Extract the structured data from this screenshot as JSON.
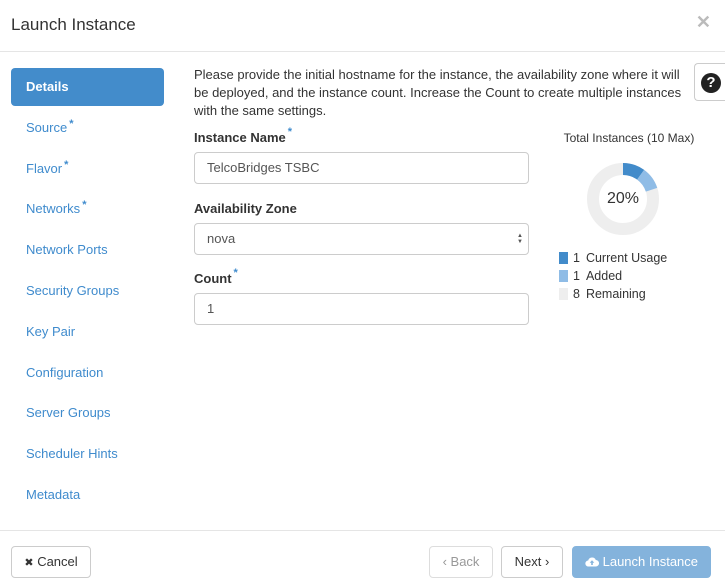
{
  "header": {
    "title": "Launch Instance",
    "close_icon": "close-icon"
  },
  "sidebar": {
    "items": [
      {
        "label": "Details",
        "active": true,
        "required": false
      },
      {
        "label": "Source",
        "active": false,
        "required": true
      },
      {
        "label": "Flavor",
        "active": false,
        "required": true
      },
      {
        "label": "Networks",
        "active": false,
        "required": true
      },
      {
        "label": "Network Ports",
        "active": false,
        "required": false
      },
      {
        "label": "Security Groups",
        "active": false,
        "required": false
      },
      {
        "label": "Key Pair",
        "active": false,
        "required": false
      },
      {
        "label": "Configuration",
        "active": false,
        "required": false
      },
      {
        "label": "Server Groups",
        "active": false,
        "required": false
      },
      {
        "label": "Scheduler Hints",
        "active": false,
        "required": false
      },
      {
        "label": "Metadata",
        "active": false,
        "required": false
      }
    ],
    "required_marker": "*"
  },
  "main": {
    "description": "Please provide the initial hostname for the instance, the availability zone where it will be deployed, and the instance count. Increase the Count to create multiple instances with the same settings.",
    "help_icon": "?",
    "form": {
      "instance_name": {
        "label": "Instance Name",
        "required": true,
        "value": "TelcoBridges TSBC"
      },
      "availability_zone": {
        "label": "Availability Zone",
        "value": "nova"
      },
      "count": {
        "label": "Count",
        "required": true,
        "value": "1"
      }
    }
  },
  "quota": {
    "title": "Total Instances (10 Max)",
    "percent_label": "20%",
    "max": 10,
    "colors": {
      "current": "#428bca",
      "added": "#8fbce6",
      "remaining": "#eeeeee"
    },
    "legend": [
      {
        "count": "1",
        "label": "Current Usage",
        "value": 1,
        "key": "current"
      },
      {
        "count": "1",
        "label": "Added",
        "value": 1,
        "key": "added"
      },
      {
        "count": "8",
        "label": "Remaining",
        "value": 8,
        "key": "remaining"
      }
    ]
  },
  "footer": {
    "cancel_label": "Cancel",
    "cancel_icon": "✖",
    "back_label": "Back",
    "back_icon": "‹",
    "next_label": "Next",
    "next_icon": "›",
    "launch_label": "Launch Instance"
  }
}
